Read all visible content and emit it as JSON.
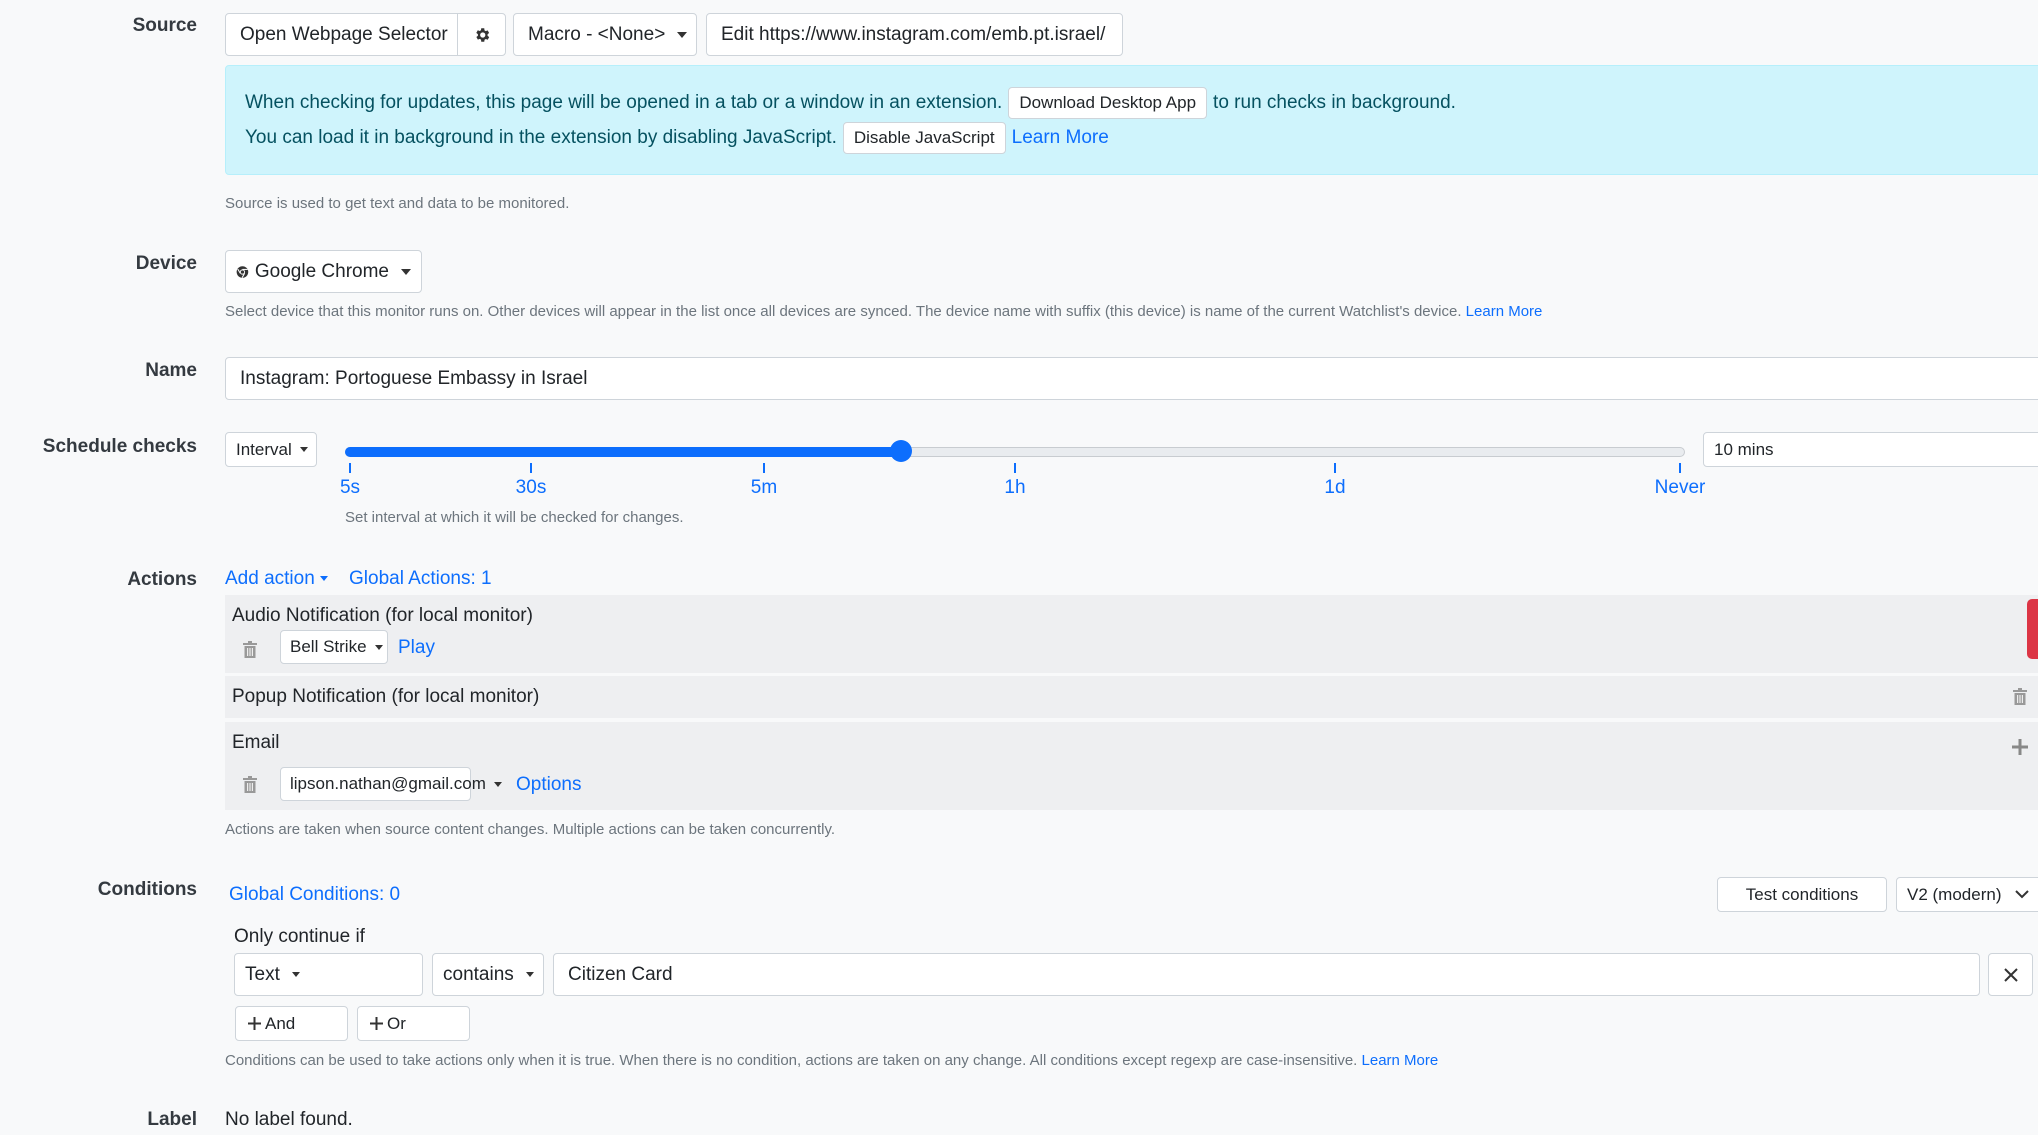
{
  "source": {
    "label": "Source",
    "open_selector_label": "Open Webpage Selector",
    "settings_icon": "gear-icon",
    "macro_label": "Macro - <None>",
    "edit_url_label": "Edit https://www.instagram.com/emb.pt.israel/",
    "alert": {
      "line1_text": "When checking for updates, this page will be opened in a tab or a window in an extension.",
      "download_button": "Download Desktop App",
      "line1_suffix": "to run checks in background.",
      "line2_text": "You can load it in background in the extension by disabling JavaScript.",
      "disable_js_button": "Disable JavaScript",
      "learn_more": "Learn More"
    },
    "help": "Source is used to get text and data to be monitored."
  },
  "device": {
    "label": "Device",
    "selected": "Google Chrome",
    "icon": "chrome-icon",
    "help": "Select device that this monitor runs on. Other devices will appear in the list once all devices are synced. The device name with suffix (this device) is name of the current Watchlist's device.",
    "learn_more": "Learn More"
  },
  "name": {
    "label": "Name",
    "value": "Instagram: Portoguese Embassy in Israel"
  },
  "schedule": {
    "label": "Schedule checks",
    "mode": "Interval",
    "value": "10 mins",
    "slider_fraction": 0.415,
    "ticks": [
      "5s",
      "30s",
      "5m",
      "1h",
      "1d",
      "Never"
    ],
    "help": "Set interval at which it will be checked for changes."
  },
  "actions": {
    "label": "Actions",
    "add_action": "Add action",
    "global_actions": "Global Actions: 1",
    "items": [
      {
        "title": "Audio Notification (for local monitor)",
        "select": "Bell Strike",
        "link": "Play"
      },
      {
        "title": "Popup Notification (for local monitor)"
      },
      {
        "title": "Email",
        "select": "lipson.nathan@gmail.com",
        "link": "Options"
      }
    ],
    "help": "Actions are taken when source content changes. Multiple actions can be taken concurrently."
  },
  "conditions": {
    "label": "Conditions",
    "global_conditions": "Global Conditions: 0",
    "test_button": "Test conditions",
    "version": "V2 (modern)",
    "only_continue": "Only continue if",
    "field": "Text",
    "operator": "contains",
    "value": "Citizen Card",
    "and_button": "And",
    "or_button": "Or",
    "help": "Conditions can be used to take actions only when it is true. When there is no condition, actions are taken on any change. All conditions except regexp are case-insensitive.",
    "learn_more": "Learn More"
  },
  "label_row": {
    "label": "Label",
    "value": "No label found."
  },
  "colors": {
    "accent": "#0d6efd",
    "alert_bg": "#cff4fc",
    "danger": "#dc3545"
  }
}
